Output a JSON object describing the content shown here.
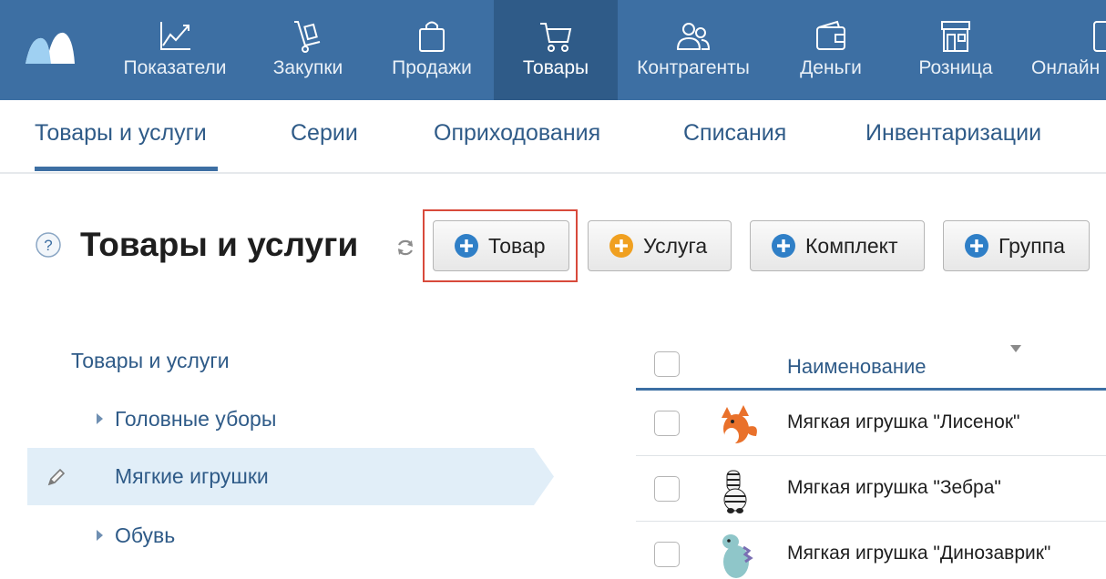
{
  "topnav": {
    "items": [
      {
        "label": "Показатели",
        "icon": "chart-icon"
      },
      {
        "label": "Закупки",
        "icon": "hand-truck-icon"
      },
      {
        "label": "Продажи",
        "icon": "shopping-bag-icon"
      },
      {
        "label": "Товары",
        "icon": "cart-icon",
        "active": true
      },
      {
        "label": "Контрагенты",
        "icon": "people-icon"
      },
      {
        "label": "Деньги",
        "icon": "wallet-icon"
      },
      {
        "label": "Розница",
        "icon": "store-icon"
      },
      {
        "label": "Онлайн",
        "icon": "device-icon"
      }
    ]
  },
  "subnav": {
    "tabs": [
      {
        "label": "Товары и услуги",
        "active": true
      },
      {
        "label": "Серии"
      },
      {
        "label": "Оприходования"
      },
      {
        "label": "Списания"
      },
      {
        "label": "Инвентаризации"
      }
    ]
  },
  "header": {
    "help": "?",
    "title": "Товары и услуги"
  },
  "actions": {
    "product": "Товар",
    "service": "Услуга",
    "kit": "Комплект",
    "group": "Группа"
  },
  "tree": {
    "root": "Товары и услуги",
    "items": [
      {
        "label": "Головные уборы",
        "expandable": true
      },
      {
        "label": "Мягкие игрушки",
        "selected": true
      },
      {
        "label": "Обувь",
        "expandable": true
      }
    ]
  },
  "table": {
    "column_name": "Наименование",
    "rows": [
      {
        "name": "Мягкая игрушка \"Лисенок\"",
        "thumb": "fox-toy-image"
      },
      {
        "name": "Мягкая игрушка \"Зебра\"",
        "thumb": "zebra-toy-image"
      },
      {
        "name": "Мягкая игрушка \"Динозаврик\"",
        "thumb": "dinosaur-toy-image"
      }
    ]
  },
  "colors": {
    "topbar": "#3d6fa3",
    "topbar_active": "#2f5b88",
    "link": "#2f5b88",
    "highlight": "#d84a3b",
    "plus_blue": "#2f7fc7",
    "plus_orange": "#f0a020",
    "tree_selected": "#e1eef8"
  }
}
